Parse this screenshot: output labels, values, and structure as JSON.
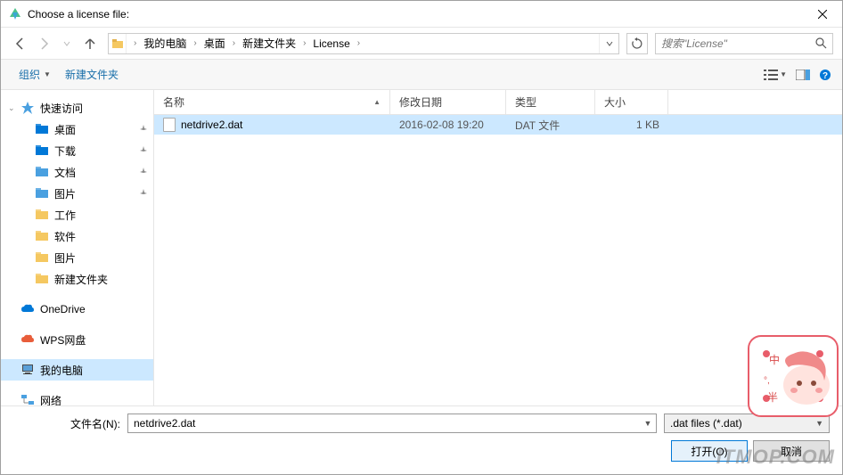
{
  "titlebar": {
    "title": "Choose a license file:"
  },
  "breadcrumb": [
    "我的电脑",
    "桌面",
    "新建文件夹",
    "License"
  ],
  "search": {
    "placeholder": "搜索\"License\""
  },
  "toolbar": {
    "organize": "组织",
    "newFolder": "新建文件夹"
  },
  "columns": {
    "name": "名称",
    "date": "修改日期",
    "type": "类型",
    "size": "大小"
  },
  "sidebar": {
    "quickAccess": "快速访问",
    "quickItems": [
      {
        "label": "桌面",
        "pinned": true,
        "iconColor": "#0078d7"
      },
      {
        "label": "下载",
        "pinned": true,
        "iconColor": "#0078d7"
      },
      {
        "label": "文档",
        "pinned": true,
        "iconColor": "#4aa0e0"
      },
      {
        "label": "图片",
        "pinned": true,
        "iconColor": "#4aa0e0"
      },
      {
        "label": "工作",
        "pinned": false,
        "iconColor": "#f5c861"
      },
      {
        "label": "软件",
        "pinned": false,
        "iconColor": "#f5c861"
      },
      {
        "label": "图片",
        "pinned": false,
        "iconColor": "#f5c861"
      },
      {
        "label": "新建文件夹",
        "pinned": false,
        "iconColor": "#f5c861"
      }
    ],
    "oneDrive": "OneDrive",
    "wps": "WPS网盘",
    "thisPC": "我的电脑",
    "network": "网络"
  },
  "files": [
    {
      "name": "netdrive2.dat",
      "date": "2016-02-08 19:20",
      "type": "DAT 文件",
      "size": "1 KB",
      "selected": true
    }
  ],
  "footer": {
    "label": "文件名(N):",
    "value": "netdrive2.dat",
    "filter": ".dat files (*.dat)",
    "open": "打开(O)",
    "cancel": "取消"
  },
  "watermark": "ITMOP.COM"
}
